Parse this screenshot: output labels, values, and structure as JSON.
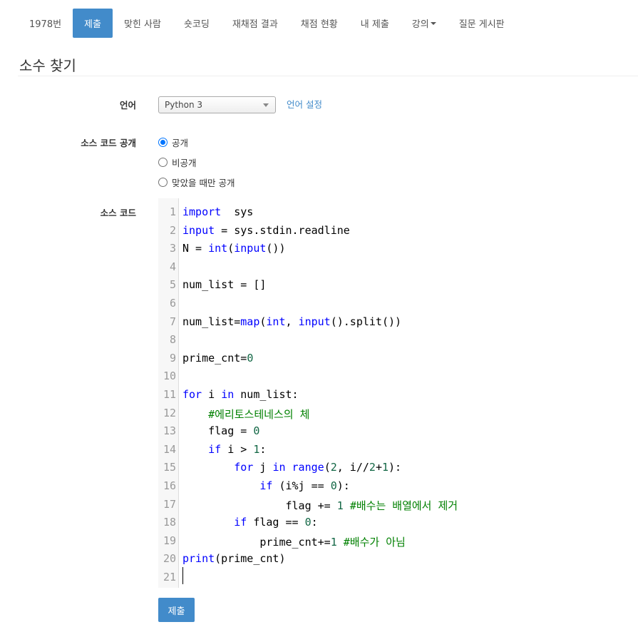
{
  "nav": {
    "items": [
      {
        "label": "1978번",
        "active": false
      },
      {
        "label": "제출",
        "active": true
      },
      {
        "label": "맞힌 사람",
        "active": false
      },
      {
        "label": "숏코딩",
        "active": false
      },
      {
        "label": "재채점 결과",
        "active": false
      },
      {
        "label": "채점 현황",
        "active": false
      },
      {
        "label": "내 제출",
        "active": false
      },
      {
        "label": "강의",
        "active": false,
        "dropdown": true
      },
      {
        "label": "질문 게시판",
        "active": false
      }
    ]
  },
  "page": {
    "title": "소수 찾기"
  },
  "form": {
    "language_label": "언어",
    "language_value": "Python 3",
    "language_settings_link": "언어 설정",
    "visibility_label": "소스 코드 공개",
    "visibility_options": [
      {
        "label": "공개",
        "checked": true
      },
      {
        "label": "비공개",
        "checked": false
      },
      {
        "label": "맞았을 때만 공개",
        "checked": false
      }
    ],
    "source_label": "소스 코드",
    "submit_label": "제출"
  },
  "editor": {
    "lines": [
      [
        [
          "kw",
          "import"
        ],
        [
          "",
          "  sys"
        ]
      ],
      [
        [
          "kw",
          "input"
        ],
        [
          "",
          ""
        ],
        [
          "",
          " = sys.stdin.readline"
        ]
      ],
      [
        [
          "",
          "N = "
        ],
        [
          "kw",
          "int"
        ],
        [
          "",
          "("
        ],
        [
          "kw",
          "input"
        ],
        [
          "",
          "())"
        ]
      ],
      [],
      [
        [
          "",
          "num_list = []"
        ]
      ],
      [],
      [
        [
          "",
          "num_list="
        ],
        [
          "kw",
          "map"
        ],
        [
          "",
          "("
        ],
        [
          "kw",
          "int"
        ],
        [
          "",
          ", "
        ],
        [
          "kw",
          "input"
        ],
        [
          "",
          "().split())"
        ]
      ],
      [],
      [
        [
          "",
          "prime_cnt="
        ],
        [
          "num",
          "0"
        ]
      ],
      [],
      [
        [
          "kw",
          "for"
        ],
        [
          "",
          " i "
        ],
        [
          "kw",
          "in"
        ],
        [
          "",
          " num_list:"
        ]
      ],
      [
        [
          "",
          "    "
        ],
        [
          "cm",
          "#에리토스테네스의 체"
        ]
      ],
      [
        [
          "",
          "    flag = "
        ],
        [
          "num",
          "0"
        ]
      ],
      [
        [
          "",
          "    "
        ],
        [
          "kw",
          "if"
        ],
        [
          "",
          " i > "
        ],
        [
          "num",
          "1"
        ],
        [
          "",
          ":"
        ]
      ],
      [
        [
          "",
          "        "
        ],
        [
          "kw",
          "for"
        ],
        [
          "",
          " j "
        ],
        [
          "kw",
          "in"
        ],
        [
          "",
          ""
        ],
        [
          "kw",
          " range"
        ],
        [
          "",
          "("
        ],
        [
          "num",
          "2"
        ],
        [
          "",
          ", i//"
        ],
        [
          "num",
          "2"
        ],
        [
          "",
          "+"
        ],
        [
          "num",
          "1"
        ],
        [
          "",
          "):"
        ]
      ],
      [
        [
          "",
          "            "
        ],
        [
          "kw",
          "if"
        ],
        [
          "",
          " (i%j == "
        ],
        [
          "num",
          "0"
        ],
        [
          "",
          "):"
        ]
      ],
      [
        [
          "",
          "                flag += "
        ],
        [
          "num",
          "1"
        ],
        [
          "",
          " "
        ],
        [
          "cm",
          "#배수는 배열에서 제거"
        ]
      ],
      [
        [
          "",
          "        "
        ],
        [
          "kw",
          "if"
        ],
        [
          "",
          " flag == "
        ],
        [
          "num",
          "0"
        ],
        [
          "",
          ":"
        ]
      ],
      [
        [
          "",
          "            prime_cnt+="
        ],
        [
          "num",
          "1"
        ],
        [
          "",
          " "
        ],
        [
          "cm",
          "#배수가 아님"
        ]
      ],
      [
        [
          "kw",
          "print"
        ],
        [
          "",
          "(prime_cnt)"
        ]
      ],
      []
    ]
  }
}
